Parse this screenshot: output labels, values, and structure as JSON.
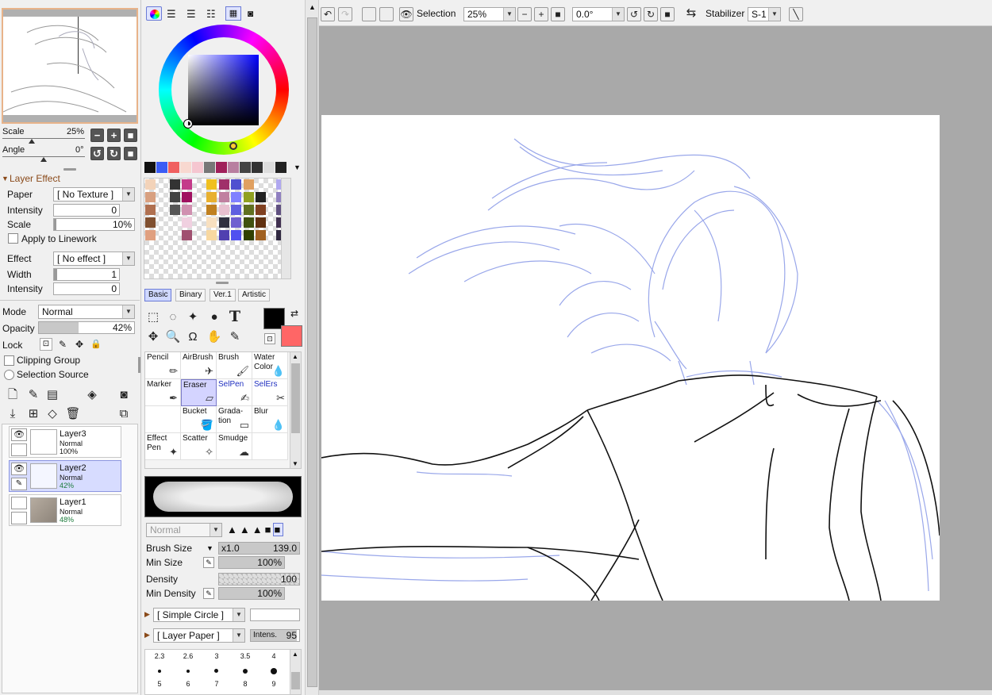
{
  "navigator": {
    "scale_label": "Scale",
    "scale_value": "25%",
    "angle_label": "Angle",
    "angle_value": "0°"
  },
  "layer_effect": {
    "title": "Layer Effect",
    "paper_label": "Paper",
    "paper_value": "[ No Texture ]",
    "intensity_label": "Intensity",
    "intensity_value": "0",
    "scale_label": "Scale",
    "scale_value": "10%",
    "apply_linework": "Apply to Linework",
    "effect_label": "Effect",
    "effect_value": "[ No effect ]",
    "width_label": "Width",
    "width_value": "1",
    "intensity2_label": "Intensity",
    "intensity2_value": "0"
  },
  "layer_props": {
    "mode_label": "Mode",
    "mode_value": "Normal",
    "opacity_label": "Opacity",
    "opacity_value": "42%",
    "opacity_fraction": 0.42,
    "lock_label": "Lock",
    "clipping_group": "Clipping Group",
    "selection_source": "Selection Source"
  },
  "layers": [
    {
      "name": "Layer3",
      "mode": "Normal",
      "opacity": "100%"
    },
    {
      "name": "Layer2",
      "mode": "Normal",
      "opacity": "42%"
    },
    {
      "name": "Layer1",
      "mode": "Normal",
      "opacity": "48%"
    }
  ],
  "tool_tabs": [
    "Basic",
    "Binary",
    "Ver.1",
    "Artistic"
  ],
  "tools": [
    {
      "label": "Pencil"
    },
    {
      "label": "AirBrush"
    },
    {
      "label": "Brush"
    },
    {
      "label": "Water\nColor"
    },
    {
      "label": "Marker"
    },
    {
      "label": "Eraser"
    },
    {
      "label": "SelPen"
    },
    {
      "label": "SelErs"
    },
    {
      "label": ""
    },
    {
      "label": "Bucket"
    },
    {
      "label": "Grada-\ntion"
    },
    {
      "label": "Blur"
    },
    {
      "label": "Effect\nPen"
    },
    {
      "label": "Scatter"
    },
    {
      "label": "Smudge"
    },
    {
      "label": ""
    }
  ],
  "brush": {
    "blend_value": "Normal",
    "size_label": "Brush Size",
    "size_mult": "x1.0",
    "size_value": "139.0",
    "min_size_label": "Min Size",
    "min_size_value": "100%",
    "density_label": "Density",
    "density_value": "100",
    "min_density_label": "Min Density",
    "min_density_value": "100%",
    "shape_value": "[ Simple Circle ]",
    "texture_value": "[ Layer Paper ]",
    "intens_label": "Intens.",
    "intens_value": "95"
  },
  "brush_sizes": [
    "2.3",
    "2.6",
    "3",
    "3.5",
    "4",
    "5",
    "6",
    "7",
    "8",
    "9"
  ],
  "toolbar": {
    "selection_label": "Selection",
    "zoom_value": "25%",
    "rotation_value": "0.0°",
    "stabilizer_label": "Stabilizer",
    "stabilizer_value": "S-1"
  },
  "colors": {
    "accent": "#6b7bd6",
    "primary_color": "#000000",
    "secondary_color": "#ff6666",
    "canvas_bg": "#a9a9a9",
    "sketch_line": "#8f9ee8"
  }
}
